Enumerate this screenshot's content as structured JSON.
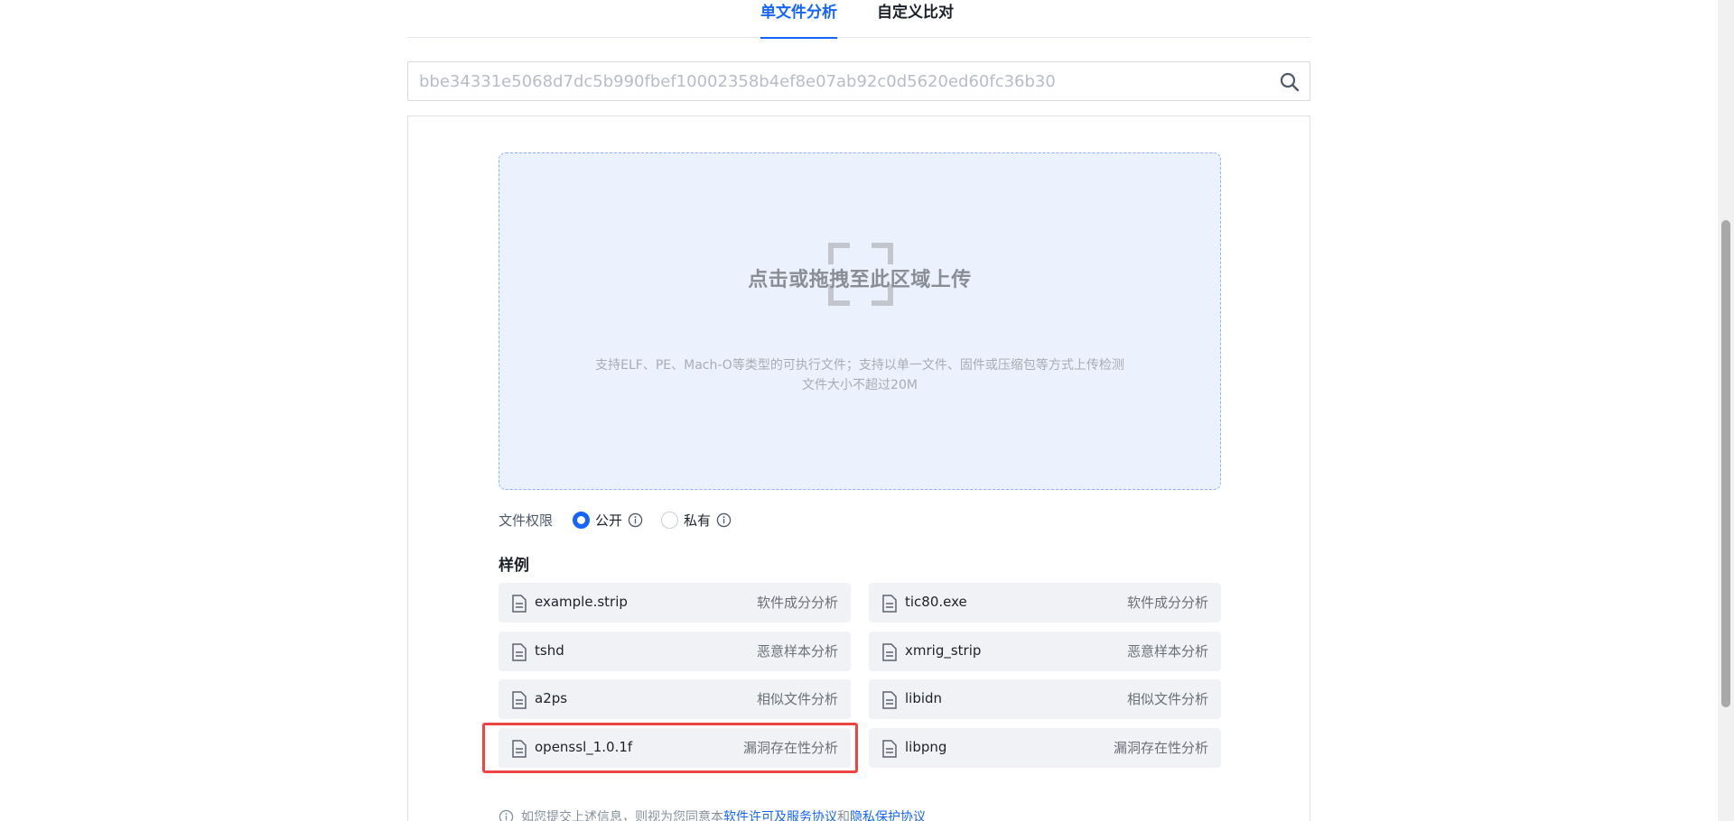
{
  "tabs": [
    {
      "label": "单文件分析",
      "active": true
    },
    {
      "label": "自定义比对",
      "active": false
    }
  ],
  "search": {
    "value": "",
    "placeholder": "bbe34331e5068d7dc5b990fbef10002358b4ef8e07ab92c0d5620ed60fc36b30",
    "icon": "search-icon"
  },
  "upload": {
    "title": "点击或拖拽至此区域上传",
    "description": "支持ELF、PE、Mach-O等类型的可执行文件；支持以单一文件、固件或压缩包等方式上传检测",
    "limit": "文件大小不超过20M",
    "icon": "upload-scan-icon"
  },
  "permission": {
    "label": "文件权限",
    "options": [
      {
        "label": "公开",
        "checked": true
      },
      {
        "label": "私有",
        "checked": false
      }
    ]
  },
  "samples": {
    "title": "样例",
    "items": [
      {
        "name": "example.strip",
        "type": "软件成分分析"
      },
      {
        "name": "tic80.exe",
        "type": "软件成分分析"
      },
      {
        "name": "tshd",
        "type": "恶意样本分析"
      },
      {
        "name": "xmrig_strip",
        "type": "恶意样本分析"
      },
      {
        "name": "a2ps",
        "type": "相似文件分析"
      },
      {
        "name": "libidn",
        "type": "相似文件分析"
      },
      {
        "name": "openssl_1.0.1f",
        "type": "漏洞存在性分析"
      },
      {
        "name": "libpng",
        "type": "漏洞存在性分析"
      }
    ]
  },
  "footer": {
    "prefix": "如您提交上述信息，则视为您同意本",
    "link1": "软件许可及服务协议",
    "joiner": "和",
    "link2": "隐私保护协议"
  },
  "colors": {
    "accent": "#1664ff",
    "highlight": "#ef4444",
    "dropzone_bg": "#ebf2fd"
  }
}
